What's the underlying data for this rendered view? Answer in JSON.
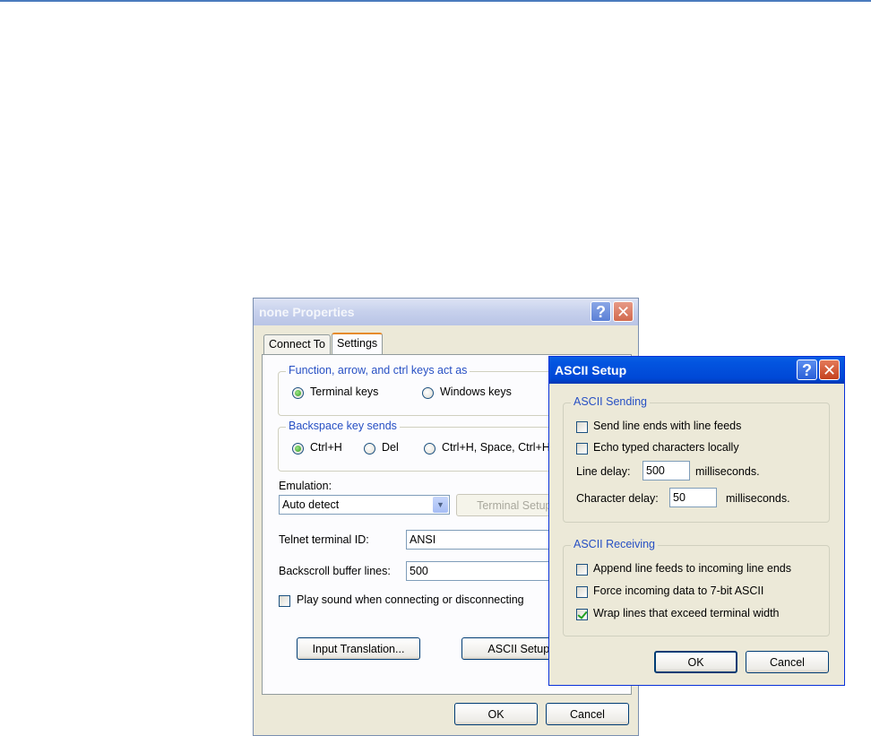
{
  "props": {
    "title": "none Properties",
    "help_glyph": "?",
    "close_glyph": "✕",
    "tabs": [
      {
        "label": "Connect To",
        "active": false
      },
      {
        "label": "Settings",
        "active": true
      }
    ],
    "function_keys": {
      "group_label": "Function, arrow, and ctrl keys act as",
      "options": [
        "Terminal keys",
        "Windows keys"
      ],
      "selected": "Terminal keys"
    },
    "backspace": {
      "group_label": "Backspace key sends",
      "options": [
        "Ctrl+H",
        "Del",
        "Ctrl+H, Space, Ctrl+H"
      ],
      "selected": "Ctrl+H"
    },
    "emulation": {
      "label": "Emulation:",
      "value": "Auto detect",
      "terminal_setup_label": "Terminal Setup..."
    },
    "telnet_id": {
      "label": "Telnet terminal ID:",
      "value": "ANSI"
    },
    "backscroll": {
      "label": "Backscroll buffer lines:",
      "value": "500"
    },
    "play_sound": {
      "label": "Play sound when connecting or disconnecting",
      "checked": false
    },
    "input_translation_label": "Input Translation...",
    "ascii_setup_label": "ASCII Setup...",
    "ok_label": "OK",
    "cancel_label": "Cancel"
  },
  "ascii": {
    "title": "ASCII Setup",
    "help_glyph": "?",
    "close_glyph": "✕",
    "sending": {
      "group_label": "ASCII Sending",
      "send_line_ends": {
        "label": "Send line ends with line feeds",
        "checked": false
      },
      "echo_typed": {
        "label": "Echo typed characters locally",
        "checked": false
      },
      "line_delay": {
        "label": "Line delay:",
        "value": "500",
        "unit": "milliseconds."
      },
      "char_delay": {
        "label": "Character delay:",
        "value": "50",
        "unit": "milliseconds."
      }
    },
    "receiving": {
      "group_label": "ASCII Receiving",
      "append_lf": {
        "label": "Append line feeds to incoming line ends",
        "checked": false
      },
      "force_7bit": {
        "label": "Force incoming data to 7-bit ASCII",
        "checked": false
      },
      "wrap_lines": {
        "label": "Wrap lines that exceed terminal width",
        "checked": true
      }
    },
    "ok_label": "OK",
    "cancel_label": "Cancel"
  },
  "colors": {
    "xp_title_active": "#0055e5",
    "xp_face": "#ece9d8",
    "group_label": "#2750c4",
    "tab_highlight": "#e68b2c"
  }
}
